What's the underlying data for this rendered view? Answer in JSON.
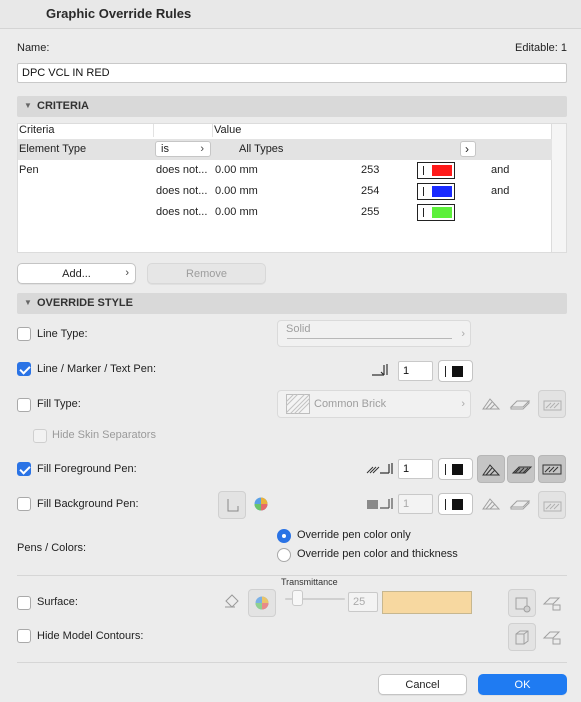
{
  "window": {
    "title": "Graphic Override Rules"
  },
  "name": {
    "label": "Name:",
    "editable": "Editable: 1",
    "value": "DPC VCL IN RED"
  },
  "criteria": {
    "header": "CRITERIA",
    "columns": [
      "Criteria",
      "Value"
    ],
    "element_type_row": {
      "criteria": "Element Type",
      "op": "is",
      "value": "All Types"
    },
    "pen_rows": [
      {
        "criteria": "Pen",
        "op": "does not...",
        "value": "0.00 mm",
        "pen": "253",
        "color": "#ff1a1a",
        "conj": "and"
      },
      {
        "criteria": "",
        "op": "does not...",
        "value": "0.00 mm",
        "pen": "254",
        "color": "#1a2bff",
        "conj": "and"
      },
      {
        "criteria": "",
        "op": "does not...",
        "value": "0.00 mm",
        "pen": "255",
        "color": "#5cf03a",
        "conj": ""
      }
    ],
    "add_label": "Add...",
    "remove_label": "Remove"
  },
  "override": {
    "header": "OVERRIDE STYLE",
    "line_type": {
      "label": "Line Type:",
      "value": "Solid",
      "checked": false
    },
    "line_pen": {
      "label": "Line / Marker / Text Pen:",
      "value": "1",
      "checked": true
    },
    "fill_type": {
      "label": "Fill Type:",
      "value": "Common Brick",
      "checked": false
    },
    "hide_skin": {
      "label": "Hide Skin Separators"
    },
    "fill_fg": {
      "label": "Fill Foreground Pen:",
      "value": "1",
      "checked": true
    },
    "fill_bg": {
      "label": "Fill Background Pen:",
      "value": "1",
      "checked": false
    },
    "pens_colors": {
      "label": "Pens / Colors:",
      "options": [
        "Override pen color only",
        "Override pen color and thickness"
      ],
      "selected": 0
    },
    "surface": {
      "label": "Surface:",
      "transmittance_label": "Transmittance",
      "transmittance": "25",
      "color": "#f7d8a0",
      "checked": false
    },
    "hide_contours": {
      "label": "Hide Model Contours:",
      "checked": false
    }
  },
  "footer": {
    "cancel": "Cancel",
    "ok": "OK"
  }
}
